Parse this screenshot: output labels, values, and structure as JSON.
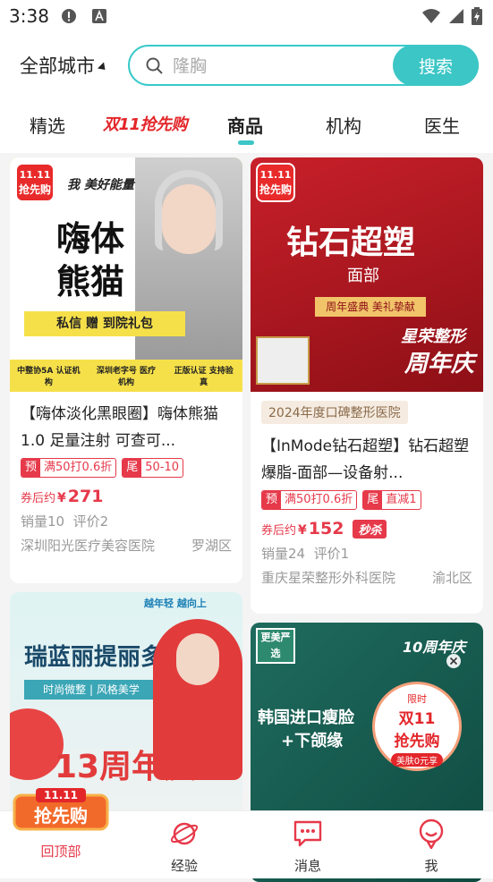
{
  "status": {
    "time": "3:38"
  },
  "header": {
    "city": "全部城市",
    "search_placeholder": "隆胸",
    "search_button": "搜索"
  },
  "tabs": [
    {
      "label": "精选"
    },
    {
      "label": "双11抢先购"
    },
    {
      "label": "商品"
    },
    {
      "label": "机构"
    },
    {
      "label": "医生"
    }
  ],
  "cards": [
    {
      "badge": [
        "11.11",
        "抢先购"
      ],
      "banner": {
        "line1": "嗨体",
        "line2": "熊猫",
        "top": "我 美好能量",
        "strip": "私信 赠 到院礼包",
        "footer": [
          "中整协5A 认证机构",
          "深圳老字号 医疗机构",
          "正版认证 支持验真"
        ]
      },
      "title": "【嗨体淡化黑眼圈】嗨体熊猫1.0 足量注射 可查可...",
      "tags": [
        {
          "k": "预",
          "v": "满50打0.6折"
        },
        {
          "k": "尾",
          "v": "50-10"
        }
      ],
      "price_label": "券后约",
      "price": "271",
      "sales": "销量10",
      "reviews": "评价2",
      "hospital": "深圳阳光医疗美容医院",
      "district": "罗湖区"
    },
    {
      "badge": [
        "11.11",
        "抢先购"
      ],
      "banner": {
        "title": "钻石超塑",
        "sub": "面部",
        "strip": "周年盛典 美礼挚献",
        "ann1": "星荣整形",
        "ann2": "周年庆"
      },
      "year_tag": "2024年度口碑整形医院",
      "title": "【InMode钻石超塑】钻石超塑爆脂-面部—设备射...",
      "tags": [
        {
          "k": "预",
          "v": "满50打0.6折"
        },
        {
          "k": "尾",
          "v": "直减1"
        }
      ],
      "price_label": "券后约",
      "price": "152",
      "seckill": "秒杀",
      "sales": "销量24",
      "reviews": "评价1",
      "hospital": "重庆星荣整形外科医院",
      "district": "渝北区"
    },
    {
      "banner": {
        "title": "瑞蓝丽提丽多",
        "strip": "时尚微整 | 风格美学",
        "slogan": "越年轻 越向上",
        "anniv": "13周年庆"
      }
    },
    {
      "banner": {
        "corner": "更美严选",
        "title": "韩国进口瘦脸",
        "sub": "+下颌缘",
        "anniv": "10周年庆",
        "circle": [
          "限时",
          "双11",
          "抢先购",
          "美肤0元享"
        ]
      }
    }
  ],
  "bottom_nav": {
    "promo": [
      "11.11",
      "抢先购"
    ],
    "items": [
      {
        "label": "回顶部"
      },
      {
        "label": "经验"
      },
      {
        "label": "消息"
      },
      {
        "label": "我"
      }
    ]
  },
  "colors": {
    "accent": "#3cc6c6",
    "price": "#e6394a",
    "promo_red": "#e3262a"
  }
}
